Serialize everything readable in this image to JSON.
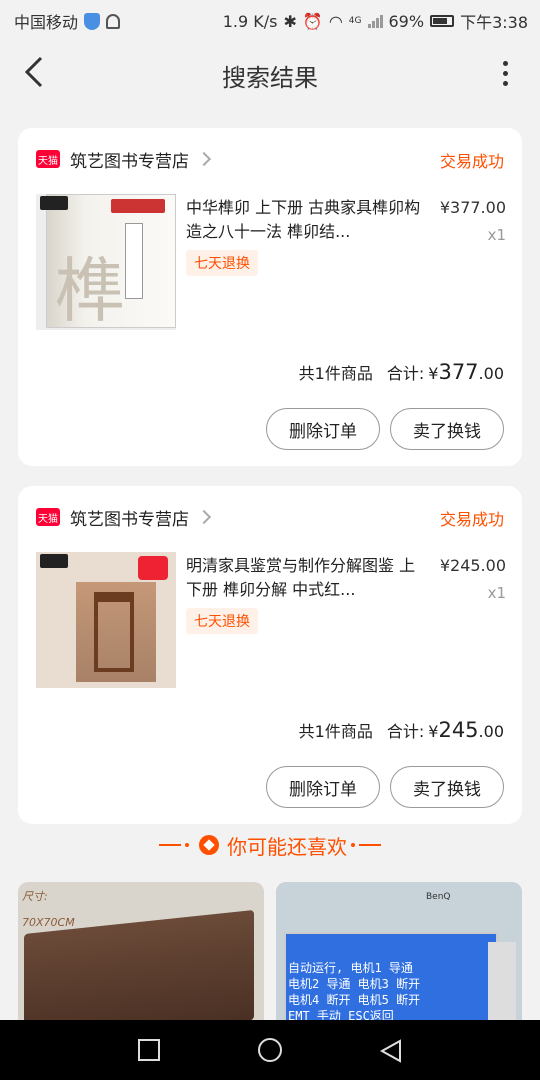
{
  "status_bar": {
    "carrier": "中国移动",
    "speed": "1.9 K/s",
    "network": "4G",
    "battery": "69%",
    "time": "下午3:38"
  },
  "header": {
    "title": "搜索结果"
  },
  "orders": [
    {
      "platform_badge": "天猫",
      "store": "筑艺图书专营店",
      "status": "交易成功",
      "product_title": "中华榫卯 上下册 古典家具榫卯构造之八十一法 榫卯结...",
      "price": "¥377.00",
      "quantity": "x1",
      "tag": "七天退换",
      "summary_count": "共1件商品",
      "summary_label": "合计:",
      "summary_currency": "¥",
      "summary_int": "377",
      "summary_dec": ".00",
      "delete_label": "删除订单",
      "sell_label": "卖了换钱"
    },
    {
      "platform_badge": "天猫",
      "store": "筑艺图书专营店",
      "status": "交易成功",
      "product_title": "明清家具鉴赏与制作分解图鉴 上下册 榫卯分解 中式红...",
      "price": "¥245.00",
      "quantity": "x1",
      "tag": "七天退换",
      "summary_count": "共1件商品",
      "summary_label": "合计:",
      "summary_currency": "¥",
      "summary_int": "245",
      "summary_dec": ".00",
      "delete_label": "删除订单",
      "sell_label": "卖了换钱"
    }
  ],
  "recommend": {
    "title": "你可能还喜欢",
    "items": [
      {
        "caption_line1": "尺寸:",
        "caption_line2": "70X70CM"
      },
      {
        "brand": "BenQ",
        "panel_line1": "自动运行, 电机1 导通",
        "panel_line2": "电机2 导通 电机3 断开",
        "panel_line3": "电机4 断开 电机5 断开",
        "panel_line4": "EMT 手动 ESC返回"
      }
    ]
  },
  "colors": {
    "accent": "#ff5000",
    "tmall": "#ff0036",
    "background": "#f2f2f2"
  },
  "icons": [
    "back-arrow-icon",
    "more-icon",
    "chevron-right-icon",
    "heart-icon",
    "nav-recent-icon",
    "nav-home-icon",
    "nav-back-icon"
  ]
}
